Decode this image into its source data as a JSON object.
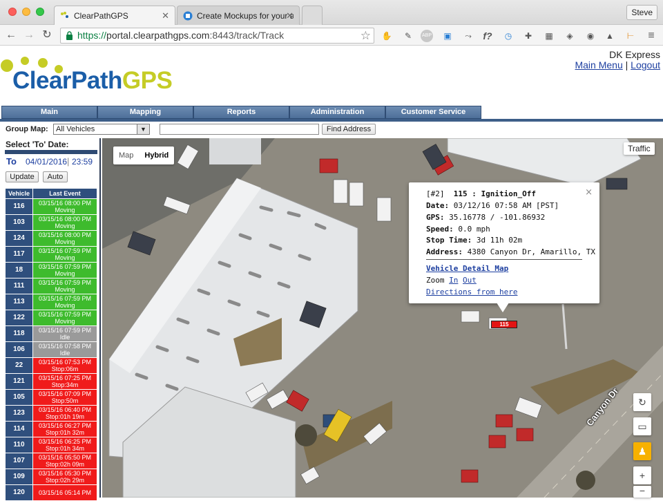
{
  "browser": {
    "tabs": [
      {
        "title": "ClearPathGPS",
        "active": true
      },
      {
        "title": "Create Mockups for your a",
        "active": false
      }
    ],
    "profile": "Steve",
    "url": {
      "scheme": "https://",
      "host": "portal.clearpathgps.com",
      "rest": ":8443/track/Track"
    },
    "extensions": [
      "pin-icon",
      "eyedropper-icon",
      "abp-icon",
      "tag-icon",
      "vector-icon",
      "fx-icon",
      "clock-icon",
      "puzzle-icon",
      "grid-icon",
      "box-icon",
      "shield-icon",
      "drive-icon",
      "ruler-icon"
    ],
    "extension_labels": {
      "abp": "ABP",
      "fx": "f?"
    }
  },
  "header": {
    "logo_part1": "ClearPath",
    "logo_part2": "GPS",
    "company": "DK Express",
    "main_menu": "Main Menu",
    "separator": "|",
    "logout": "Logout"
  },
  "nav": [
    "Main",
    "Mapping",
    "Reports",
    "Administration",
    "Customer Service"
  ],
  "groupbar": {
    "label": "Group Map:",
    "selected": "All Vehicles",
    "find_button": "Find Address"
  },
  "left_panel": {
    "title": "Select 'To' Date:",
    "to_label": "To",
    "date": "04/01/2016",
    "sep": "|",
    "time": "23:59",
    "update_button": "Update",
    "auto_button": "Auto",
    "col_vehicle": "Vehicle",
    "col_last_event": "Last Event",
    "rows": [
      {
        "vehicle": "116",
        "time": "03/15/16 08:00 PM",
        "status": "Moving",
        "state": "moving"
      },
      {
        "vehicle": "103",
        "time": "03/15/16 08:00 PM",
        "status": "Moving",
        "state": "moving"
      },
      {
        "vehicle": "124",
        "time": "03/15/16 08:00 PM",
        "status": "Moving",
        "state": "moving"
      },
      {
        "vehicle": "117",
        "time": "03/15/16 07:59 PM",
        "status": "Moving",
        "state": "moving"
      },
      {
        "vehicle": "18",
        "time": "03/15/16 07:59 PM",
        "status": "Moving",
        "state": "moving"
      },
      {
        "vehicle": "111",
        "time": "03/15/16 07:59 PM",
        "status": "Moving",
        "state": "moving"
      },
      {
        "vehicle": "113",
        "time": "03/15/16 07:59 PM",
        "status": "Moving",
        "state": "moving"
      },
      {
        "vehicle": "122",
        "time": "03/15/16 07:59 PM",
        "status": "Moving",
        "state": "moving"
      },
      {
        "vehicle": "118",
        "time": "03/15/16 07:59 PM",
        "status": "Idle",
        "state": "idle"
      },
      {
        "vehicle": "106",
        "time": "03/15/16 07:58 PM",
        "status": "Idle",
        "state": "idle"
      },
      {
        "vehicle": "22",
        "time": "03/15/16 07:53 PM",
        "status": "Stop:06m",
        "state": "stopped"
      },
      {
        "vehicle": "121",
        "time": "03/15/16 07:25 PM",
        "status": "Stop:34m",
        "state": "stopped"
      },
      {
        "vehicle": "105",
        "time": "03/15/16 07:09 PM",
        "status": "Stop:50m",
        "state": "stopped"
      },
      {
        "vehicle": "123",
        "time": "03/15/16 06:40 PM",
        "status": "Stop:01h 19m",
        "state": "stopped"
      },
      {
        "vehicle": "114",
        "time": "03/15/16 06:27 PM",
        "status": "Stop:01h 32m",
        "state": "stopped"
      },
      {
        "vehicle": "110",
        "time": "03/15/16 06:25 PM",
        "status": "Stop:01h 34m",
        "state": "stopped"
      },
      {
        "vehicle": "107",
        "time": "03/15/16 05:50 PM",
        "status": "Stop:02h 09m",
        "state": "stopped"
      },
      {
        "vehicle": "109",
        "time": "03/15/16 05:30 PM",
        "status": "Stop:02h 29m",
        "state": "stopped"
      },
      {
        "vehicle": "120",
        "time": "03/15/16 05:14 PM",
        "status": "",
        "state": "stopped"
      }
    ]
  },
  "map": {
    "type_map": "Map",
    "type_hybrid": "Hybrid",
    "traffic": "Traffic",
    "road_label": "Canyon Dr",
    "marker_label": "115",
    "infowindow": {
      "index": "[#2]",
      "title": "115 : Ignition_Off",
      "date_label": "Date:",
      "date": "03/12/16 07:58 AM [PST]",
      "gps_label": "GPS:",
      "gps": "35.16778 / -101.86932",
      "speed_label": "Speed:",
      "speed": "0.0 mph",
      "stop_label": "Stop Time:",
      "stop": "3d 11h 02m",
      "address_label": "Address:",
      "address": "4380 Canyon Dr, Amarillo, TX",
      "detail_link": "Vehicle Detail Map",
      "zoom_label": "Zoom",
      "zoom_in": "In",
      "zoom_out": "Out",
      "directions": "Directions from here",
      "close": "×"
    },
    "controls": {
      "zoom_in": "+",
      "zoom_out": "−"
    }
  },
  "colors": {
    "moving": "#3ebb2d",
    "idle": "#9a9a9a",
    "stopped": "#f01b1b",
    "nav": "#4d6f99",
    "logo_blue": "#1b5ea8",
    "logo_green": "#c5cc26"
  }
}
